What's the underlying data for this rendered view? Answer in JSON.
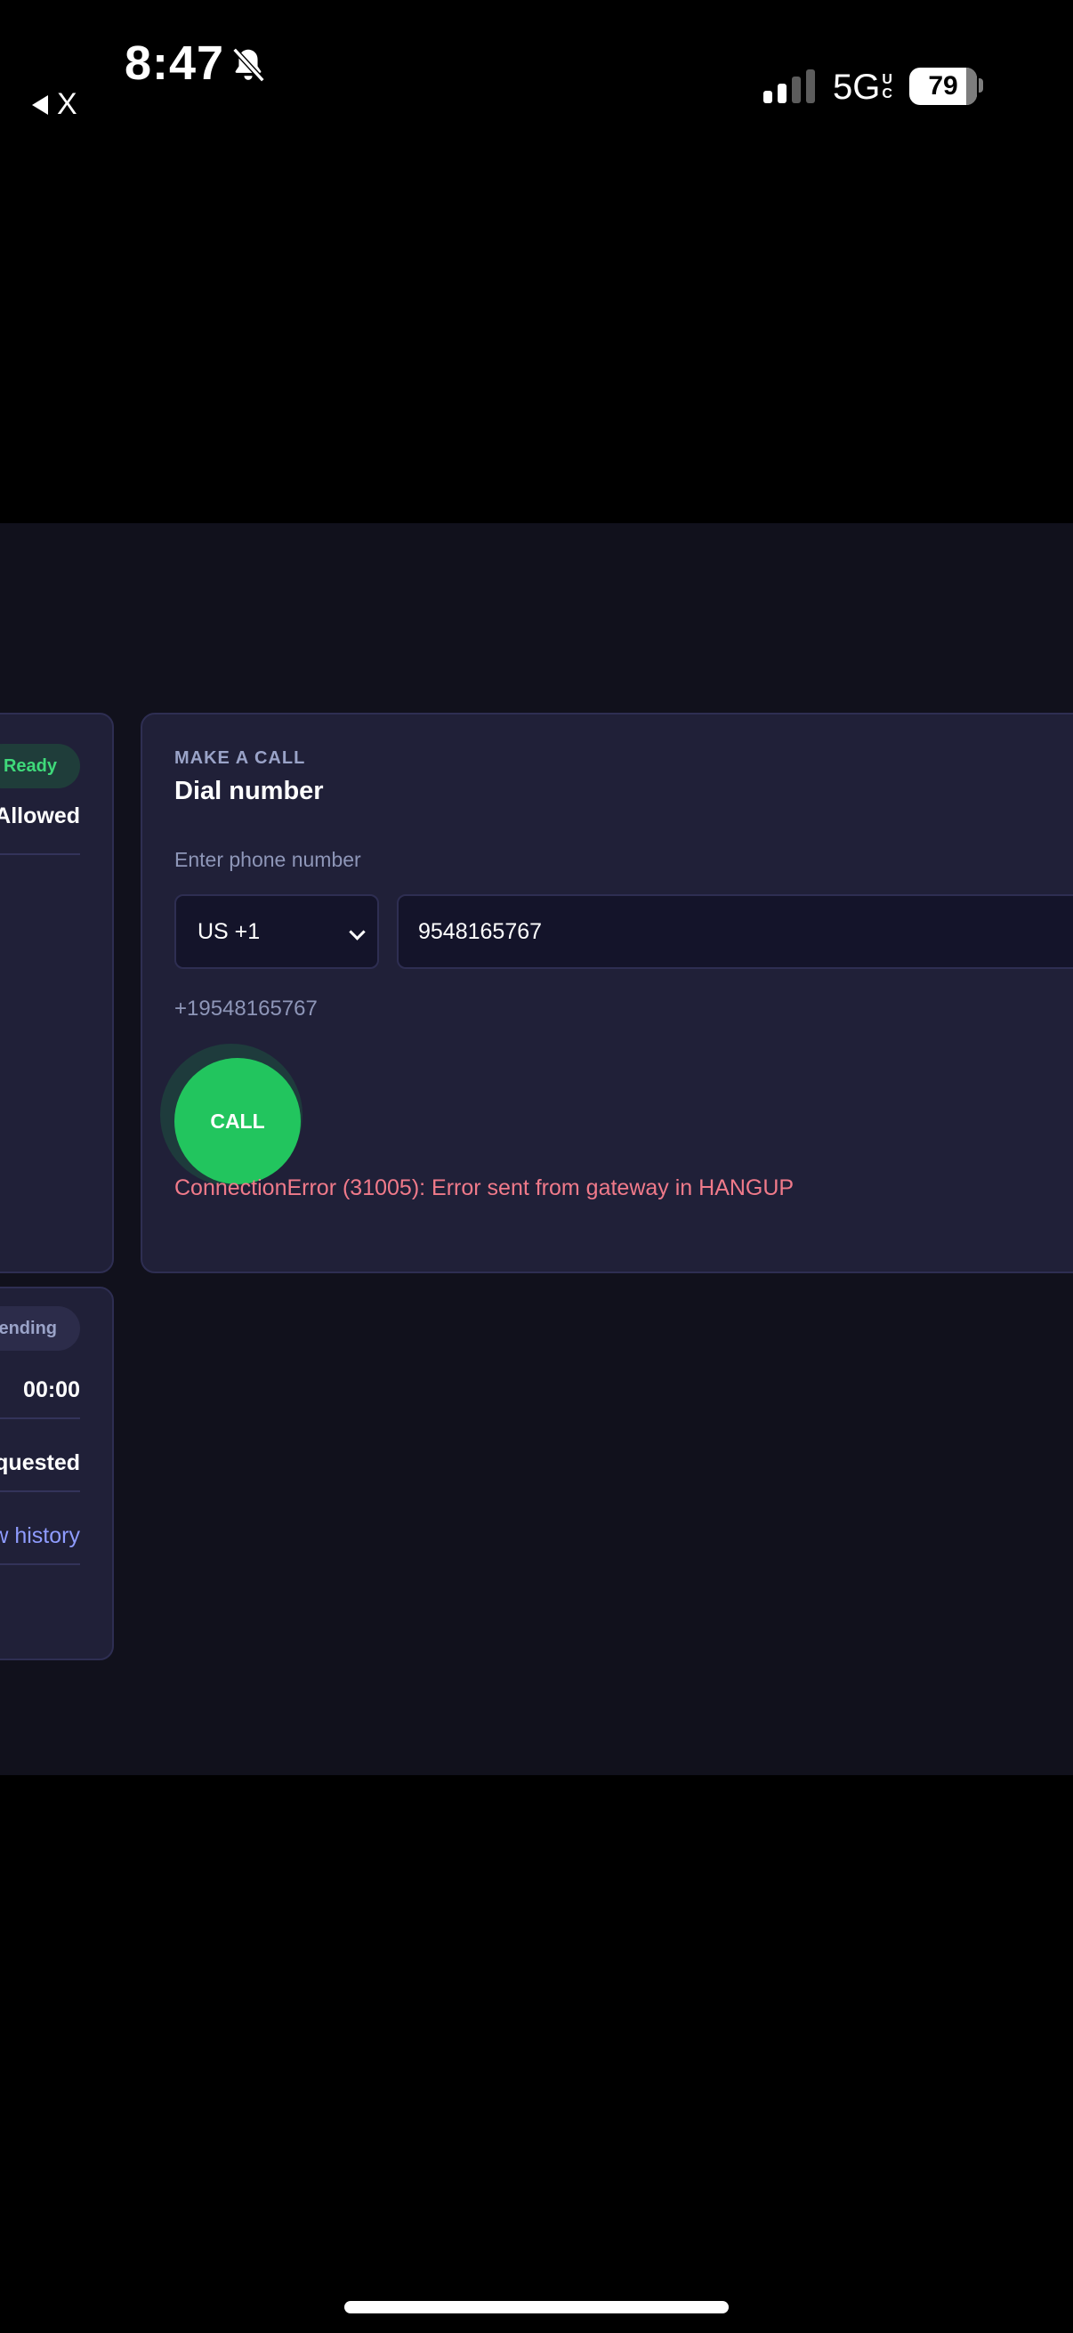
{
  "status_bar": {
    "time": "8:47",
    "back_app": "X",
    "network": "5G",
    "network_sub_top": "U",
    "network_sub_bottom": "C",
    "battery_percent": "79",
    "battery_level": 0.79
  },
  "left_panel": {
    "status_pill": "Ready",
    "permission_value": "Allowed",
    "call_status_pill": "Pending",
    "timer": "00:00",
    "state_value": "Requested",
    "history_link": "View history"
  },
  "make_call": {
    "eyebrow": "MAKE A CALL",
    "title": "Dial number",
    "field_label": "Enter phone number",
    "country_code": "US +1",
    "phone_number": "9548165767",
    "formatted_number": "+19548165767",
    "call_button": "CALL",
    "error_message": "ConnectionError (31005): Error sent from gateway in HANGUP"
  },
  "colors": {
    "page_bg": "#11111c",
    "card_bg": "#202038",
    "call_green": "#22c55e",
    "error_red": "#f07a8a",
    "ready_green": "#3fd97a"
  }
}
